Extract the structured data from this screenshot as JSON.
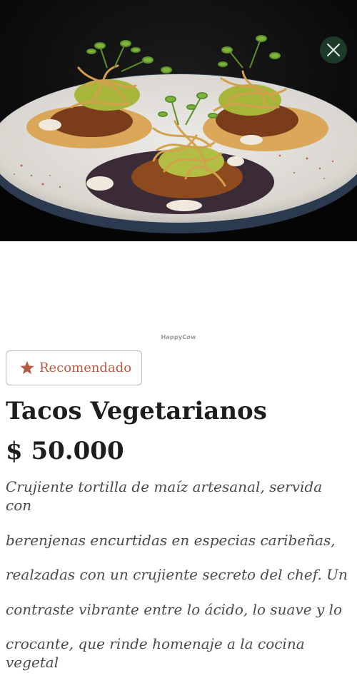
{
  "hero": {
    "alt": "Tacos Vegetarianos"
  },
  "close_icon": "close-icon",
  "watermark": "HappyCow",
  "badge": {
    "icon": "star-icon",
    "label": "Recomendado",
    "color": "#b65a44"
  },
  "dish": {
    "title": "Tacos Vegetarianos",
    "price": "$ 50.000",
    "description": [
      "Crujiente tortilla de maíz artesanal, servida con",
      "berenjenas encurtidas en especias caribeñas,",
      "realzadas con un crujiente secreto del chef. Un",
      "contraste vibrante entre lo ácido, lo suave y lo",
      "crocante, que rinde homenaje a la cocina vegetal"
    ]
  }
}
